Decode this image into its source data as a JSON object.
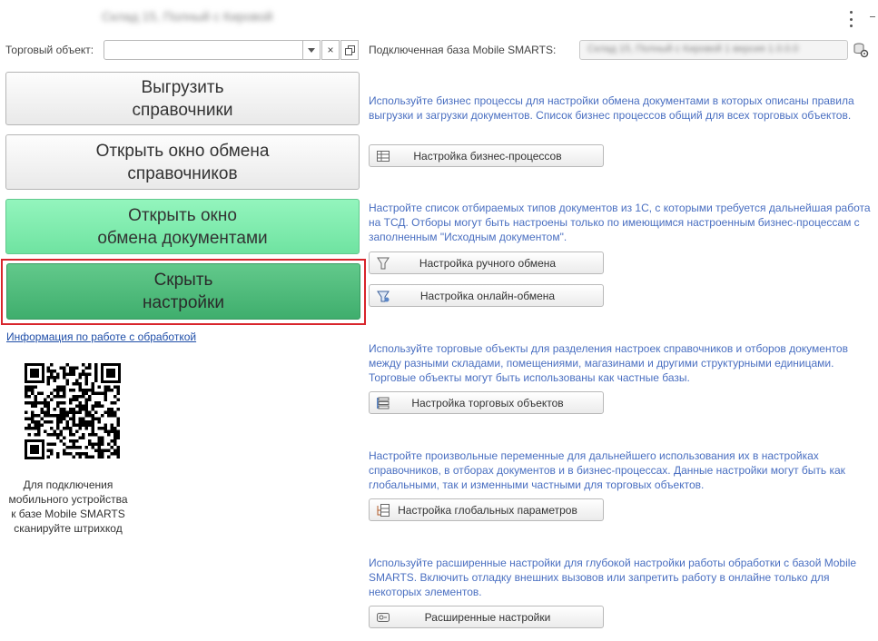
{
  "window": {
    "title": "Склад 15, Полный с Кировой"
  },
  "left": {
    "trade_object_label": "Торговый объект:",
    "trade_object_value": "",
    "buttons": {
      "upload_refs": "Выгрузить\nсправочники",
      "open_refs_exchange": "Открыть окно обмена\nсправочников",
      "open_docs_exchange": "Открыть окно\nобмена документами",
      "hide_settings": "Скрыть\nнастройки"
    },
    "info_link": "Информация по работе с обработкой",
    "qr_caption": "Для подключения\nмобильного устройства\nк базе Mobile SMARTS\nсканируйте штрихкод"
  },
  "right": {
    "mobile_db_label": "Подключенная база Mobile SMARTS:",
    "mobile_db_value": "Склад 15, Полный с Кировой 1 версия 1.0.0.0",
    "sections": [
      {
        "desc": "Используйте бизнес процессы для настройки обмена документами в которых описаны правила выгрузки и загрузки документов. Список бизнес процессов общий для всех торговых объектов.",
        "buttons": [
          {
            "label": "Настройка бизнес-процессов",
            "icon": "table-icon"
          }
        ]
      },
      {
        "desc": "Настройте список отбираемых типов документов из 1С, с которыми требуется дальнейшая работа на ТСД. Отборы могут быть настроены только по имеющимся настроенным бизнес-процессам с заполненным \"Исходным документом\".",
        "buttons": [
          {
            "label": "Настройка ручного обмена",
            "icon": "document-filter-icon"
          },
          {
            "label": "Настройка онлайн-обмена",
            "icon": "online-filter-icon"
          }
        ]
      },
      {
        "desc": "Используйте торговые объекты для разделения настроек справочников и отборов документов между разными складами, помещениями, магазинами и другими структурными единицами. Торговые объекты могут быть использованы как частные базы.",
        "buttons": [
          {
            "label": "Настройка торговых объектов",
            "icon": "stack-list-icon"
          }
        ]
      },
      {
        "desc": "Настройте произвольные переменные для дальнейшего использования их в настройках справочников, в отборах документов и в бизнес-процессах. Данные настройки могут быть как глобальными, так и изменными частными для торговых объектов.",
        "buttons": [
          {
            "label": "Настройка глобальных параметров",
            "icon": "tree-table-icon"
          }
        ]
      },
      {
        "desc": "Используйте расширенные настройки для глубокой настройки работы обработки с базой Mobile SMARTS. Включить отладку внешних вызовов или запретить работу в онлайне только для некоторых элементов.",
        "buttons": [
          {
            "label": "Расширенные настройки",
            "icon": "advanced-settings-icon"
          }
        ]
      }
    ]
  },
  "colors": {
    "accent_link": "#1f4ea8",
    "desc_text": "#4a6fc1",
    "light_green_button": "#7cebab",
    "green_button": "#4fbb7b",
    "focus_border": "#d8252c"
  }
}
